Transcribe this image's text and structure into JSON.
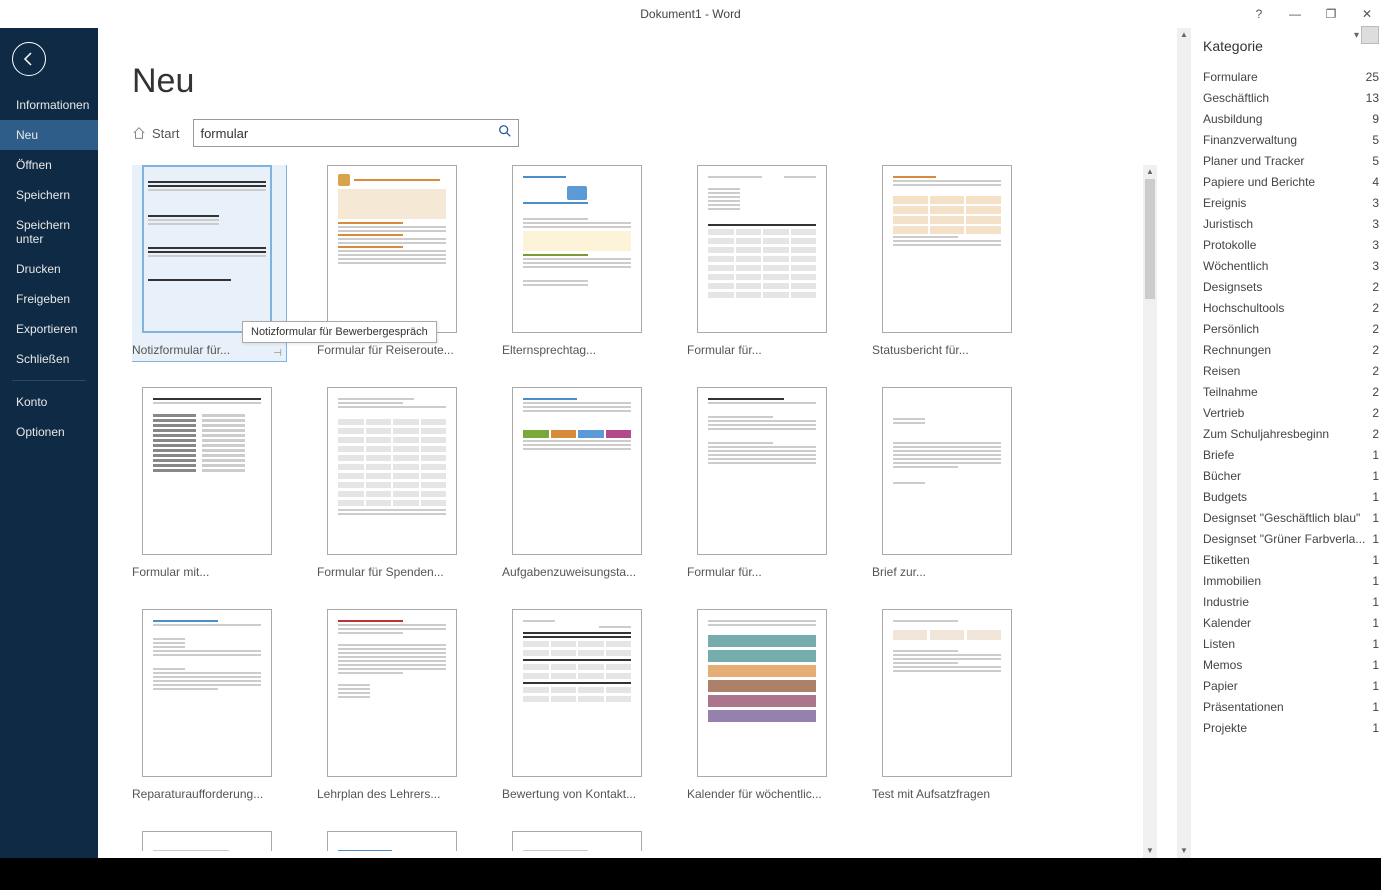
{
  "window": {
    "title": "Dokument1 - Word"
  },
  "sidebar": {
    "items": [
      {
        "label": "Informationen"
      },
      {
        "label": "Neu"
      },
      {
        "label": "Öffnen"
      },
      {
        "label": "Speichern"
      },
      {
        "label": "Speichern unter"
      },
      {
        "label": "Drucken"
      },
      {
        "label": "Freigeben"
      },
      {
        "label": "Exportieren"
      },
      {
        "label": "Schließen"
      }
    ],
    "footer": [
      {
        "label": "Konto"
      },
      {
        "label": "Optionen"
      }
    ],
    "active": 1
  },
  "page": {
    "title": "Neu",
    "home": "Start",
    "search_value": "formular"
  },
  "tooltip": "Notizformular für Bewerbergespräch",
  "templates": [
    {
      "label": "Notizformular für...",
      "style": "blackform",
      "selected": true
    },
    {
      "label": "Formular für Reiseroute...",
      "style": "beige"
    },
    {
      "label": "Elternsprechtag...",
      "style": "blueheader"
    },
    {
      "label": "Formular für...",
      "style": "checklist"
    },
    {
      "label": "Statusbericht für...",
      "style": "orangecells"
    },
    {
      "label": "Formular mit...",
      "style": "twocol"
    },
    {
      "label": "Formular für Spenden...",
      "style": "gridtable"
    },
    {
      "label": "Aufgabenzuweisungsta...",
      "style": "colortabs"
    },
    {
      "label": "Formular für...",
      "style": "discipl"
    },
    {
      "label": "Brief zur...",
      "style": "letter"
    },
    {
      "label": "Reparaturaufforderung...",
      "style": "bluetext"
    },
    {
      "label": "Lehrplan des Lehrers...",
      "style": "redheading"
    },
    {
      "label": "Bewertung von Kontakt...",
      "style": "darktable"
    },
    {
      "label": "Kalender für wöchentlic...",
      "style": "colorcal"
    },
    {
      "label": "Test mit Aufsatzfragen",
      "style": "test"
    },
    {
      "label": "",
      "style": "partial1"
    },
    {
      "label": "",
      "style": "partial2"
    },
    {
      "label": "",
      "style": "partial3"
    }
  ],
  "categories": {
    "title": "Kategorie",
    "items": [
      {
        "name": "Formulare",
        "count": 25
      },
      {
        "name": "Geschäftlich",
        "count": 13
      },
      {
        "name": "Ausbildung",
        "count": 9
      },
      {
        "name": "Finanzverwaltung",
        "count": 5
      },
      {
        "name": "Planer und Tracker",
        "count": 5
      },
      {
        "name": "Papiere und Berichte",
        "count": 4
      },
      {
        "name": "Ereignis",
        "count": 3
      },
      {
        "name": "Juristisch",
        "count": 3
      },
      {
        "name": "Protokolle",
        "count": 3
      },
      {
        "name": "Wöchentlich",
        "count": 3
      },
      {
        "name": "Designsets",
        "count": 2
      },
      {
        "name": "Hochschultools",
        "count": 2
      },
      {
        "name": "Persönlich",
        "count": 2
      },
      {
        "name": "Rechnungen",
        "count": 2
      },
      {
        "name": "Reisen",
        "count": 2
      },
      {
        "name": "Teilnahme",
        "count": 2
      },
      {
        "name": "Vertrieb",
        "count": 2
      },
      {
        "name": "Zum Schuljahresbeginn",
        "count": 2
      },
      {
        "name": "Briefe",
        "count": 1
      },
      {
        "name": "Bücher",
        "count": 1
      },
      {
        "name": "Budgets",
        "count": 1
      },
      {
        "name": "Designset \"Geschäftlich blau\"",
        "count": 1
      },
      {
        "name": "Designset \"Grüner Farbverla...",
        "count": 1
      },
      {
        "name": "Etiketten",
        "count": 1
      },
      {
        "name": "Immobilien",
        "count": 1
      },
      {
        "name": "Industrie",
        "count": 1
      },
      {
        "name": "Kalender",
        "count": 1
      },
      {
        "name": "Listen",
        "count": 1
      },
      {
        "name": "Memos",
        "count": 1
      },
      {
        "name": "Papier",
        "count": 1
      },
      {
        "name": "Präsentationen",
        "count": 1
      },
      {
        "name": "Projekte",
        "count": 1
      }
    ]
  }
}
